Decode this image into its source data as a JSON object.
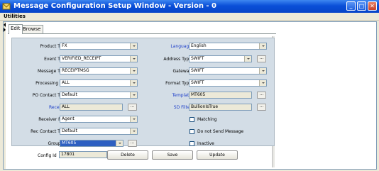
{
  "window": {
    "title": "Message Configuration Setup Window - Version - 0",
    "minimize_glyph": "_",
    "maximize_glyph": "□",
    "close_glyph": "✕"
  },
  "menu": {
    "utilities": "Utilities"
  },
  "tabs": [
    {
      "label": "Edit",
      "selected": true
    },
    {
      "label": "Browse",
      "selected": false
    }
  ],
  "form": {
    "product_type": {
      "label": "Product Type",
      "value": "FX"
    },
    "event_type": {
      "label": "Event Type",
      "value": "VERIFIED_RECEIPT"
    },
    "message_type": {
      "label": "Message Type",
      "value": "RECEIPTMSG"
    },
    "processing_org": {
      "label": "Processing Org",
      "value": "ALL"
    },
    "po_contact_type": {
      "label": "PO Contact Type",
      "value": "Default"
    },
    "receiver": {
      "label": "Receiver",
      "value": "ALL",
      "button": "..."
    },
    "receiver_role": {
      "label": "Receiver Role",
      "value": "Agent"
    },
    "rec_contact_type": {
      "label": "Rec Contact Type",
      "value": "Default"
    },
    "grouping": {
      "label": "Grouping",
      "value": "MT605",
      "button": "..."
    },
    "language": {
      "label": "Language",
      "value": "English"
    },
    "address_type": {
      "label": "Address Type",
      "value": "SWIFT",
      "button": "..."
    },
    "gateway": {
      "label": "Gateway",
      "value": "SWIFT"
    },
    "format_type": {
      "label": "Format Type",
      "value": "SWIFT"
    },
    "template": {
      "label": "Template",
      "value": "MT605",
      "button": "..."
    },
    "sd_filter": {
      "label": "SD Filter",
      "value": "BullionIsTrue",
      "button": "..."
    },
    "matching": {
      "label": "Matching",
      "checked": false
    },
    "do_not_send": {
      "label": "Do not Send Message",
      "checked": false
    },
    "inactive": {
      "label": "Inactive",
      "checked": false
    }
  },
  "footer": {
    "config_id_label": "Config Id",
    "config_id_value": "17801",
    "delete": "Delete",
    "save": "Save",
    "update": "Update"
  },
  "colors": {
    "title_bar": "#0a4fd8",
    "panel": "#d3dde6",
    "link_label": "#1a3cc8",
    "selected_field": "#2d5fc1"
  }
}
